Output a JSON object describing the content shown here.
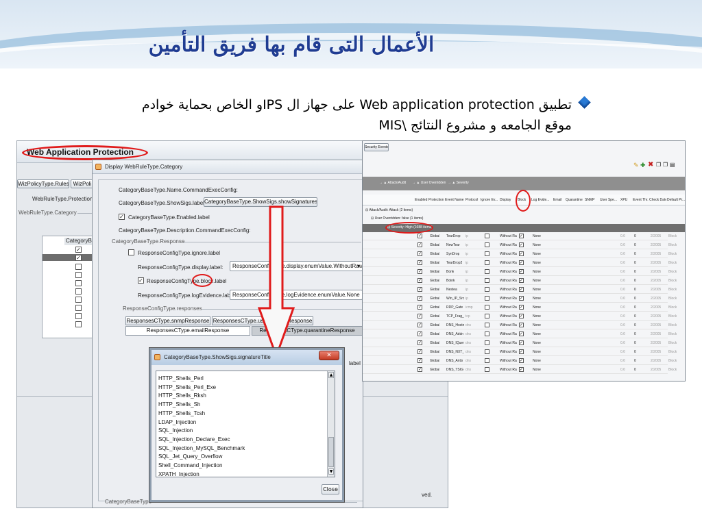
{
  "slide": {
    "title": "الأعمال التى قام بها فريق التأمين",
    "bullet_line1": "تطبيق  Web application protection على جهاز ال   IPSو الخاص بحماية خوادم",
    "bullet_line2": "موقع الجامعه و مشروع النتائج \\MIS"
  },
  "main_app": {
    "title": "Web Application Protection",
    "tab1": "WizPolicyType.Rules",
    "tab2": "WizPoli",
    "protection_label": "WebRuleType.ProtectionD",
    "category_group": "WebRuleType.Category",
    "table_header": "CategoryB",
    "bottom_text": "ved."
  },
  "dialog": {
    "title": "Display WebRuleType.Category",
    "command_exec": "CategoryBaseType.Name.CommandExecConfig:",
    "show_sigs_label": "CategoryBaseType.ShowSigs.label:",
    "show_sigs_button": "CategoryBaseType.ShowSigs.showSignatures",
    "enabled_label": "CategoryBaseType.Enabled.label",
    "description": "CategoryBaseType.Description.CommandExecConfig:",
    "response_group": "CategoryBaseType.Response",
    "ignore_label": "ResponseConfigType.ignore.label",
    "display_label": "ResponseConfigType.display.label:",
    "display_value": "ResponseConfigType.display.enumValue.WithoutRaw",
    "block_label_pre": "ResponseConfigType.",
    "block_label_word": "block",
    "block_label_post": ".label",
    "log_label": "ResponseConfigType.logEvidence.label:",
    "log_value": "ResponseConfigType.logEvidence.enumValue.None",
    "responses_group": "ResponseConfigType.responses",
    "tab_snmp": "ResponsesCType.snmpResponse",
    "tab_user": "ResponsesCType.userDefinedResponse",
    "tab_email": "ResponsesCType.emailResponse",
    "tab_quarantine": "ResponsesCType.quarantineResponse",
    "partial_label": "label",
    "bottom_group": "CategoryBaseType"
  },
  "list_popup": {
    "title": "CategoryBaseType.ShowSigs.signatureTitle",
    "items": [
      "HTTP_Shells_Perl",
      "HTTP_Shells_Perl_Exe",
      "HTTP_Shells_Rksh",
      "HTTP_Shells_Sh",
      "HTTP_Shells_Tcsh",
      "LDAP_Injection",
      "SQL_Injection",
      "SQL_Injection_Declare_Exec",
      "SQL_Injection_MySQL_Benchmark",
      "SQL_Jet_Query_Overflow",
      "Shell_Command_Injection",
      "XPATH_Injection"
    ],
    "close_button": "Close"
  },
  "security_events": {
    "tab": "Security Events",
    "toolbar_icons": [
      "edit-icon",
      "add-icon",
      "delete-icon",
      "copy-icon",
      "paste-icon",
      "filter-icon"
    ],
    "group_by": [
      "Attack/Audit",
      "User Overridden",
      "Severity"
    ],
    "columns": [
      "Enabled",
      "Protection...",
      "Event Name",
      "Protocol",
      "Ignore Ev...",
      "Display",
      "Block",
      "Log Evide...",
      "Email",
      "Quarantine",
      "SNMP",
      "User Spe...",
      "XPU",
      "Event Thr...",
      "Check Date",
      "Default Pr..."
    ],
    "tree": [
      "Attack/Audit: Attack (2 items)",
      "User Overridden: false (1 items)",
      "Severity: High (1688 items)"
    ],
    "rows": [
      [
        "Global",
        "TearDrop",
        "ip",
        "Without Ra",
        "None",
        "0.0",
        "0",
        "2/2005",
        "Block"
      ],
      [
        "Global",
        "NewTear",
        "ip",
        "Without Ra",
        "None",
        "0.0",
        "0",
        "2/2005",
        "Block"
      ],
      [
        "Global",
        "SynDrop",
        "ip",
        "Without Ra",
        "None",
        "0.0",
        "0",
        "2/2005",
        "Block"
      ],
      [
        "Global",
        "TearDrop2",
        "ip",
        "Without Ra",
        "None",
        "0.0",
        "0",
        "2/2005",
        "Block"
      ],
      [
        "Global",
        "Bonk",
        "ip",
        "Without Ra",
        "None",
        "0.0",
        "0",
        "2/2005",
        "Block"
      ],
      [
        "Global",
        "Boink",
        "ip",
        "Without Ra",
        "None",
        "0.0",
        "0",
        "2/2005",
        "Block"
      ],
      [
        "Global",
        "Nestea",
        "ip",
        "Without Ra",
        "None",
        "0.0",
        "0",
        "2/2005",
        "Block"
      ],
      [
        "Global",
        "Win_IP_Src",
        "ip",
        "Without Ra",
        "None",
        "0.0",
        "0",
        "2/2005",
        "Block"
      ],
      [
        "Global",
        "RDP_Gate",
        "icmp",
        "Without Ra",
        "None",
        "0.0",
        "0",
        "2/2005",
        "Block"
      ],
      [
        "Global",
        "TCP_Frag_",
        "tcp",
        "Without Ra",
        "None",
        "0.0",
        "0",
        "2/2005",
        "Block"
      ],
      [
        "Global",
        "DNS_Hostn",
        "dns",
        "Without Ra",
        "None",
        "0.0",
        "0",
        "2/2005",
        "Block"
      ],
      [
        "Global",
        "DNS_Addn",
        "dns",
        "Without Ra",
        "None",
        "0.0",
        "0",
        "2/2005",
        "Block"
      ],
      [
        "Global",
        "DNS_IQuer",
        "dns",
        "Without Ra",
        "None",
        "0.0",
        "0",
        "2/2005",
        "Block"
      ],
      [
        "Global",
        "DNS_NXT_",
        "dns",
        "Without Ra",
        "None",
        "0.0",
        "0",
        "2/2005",
        "Block"
      ],
      [
        "Global",
        "DNS_Antis",
        "dns",
        "Without Ra",
        "None",
        "0.0",
        "0",
        "2/2005",
        "Block"
      ],
      [
        "Global",
        "DNS_TSIG",
        "dns",
        "Without Ra",
        "None",
        "0.0",
        "0",
        "2/2005",
        "Block"
      ]
    ]
  },
  "colors": {
    "title_blue": "#1f3c92",
    "highlight_red": "#e01b1b",
    "selection_gray": "#6d6d6d",
    "arrow_red": "#e01b1b"
  }
}
